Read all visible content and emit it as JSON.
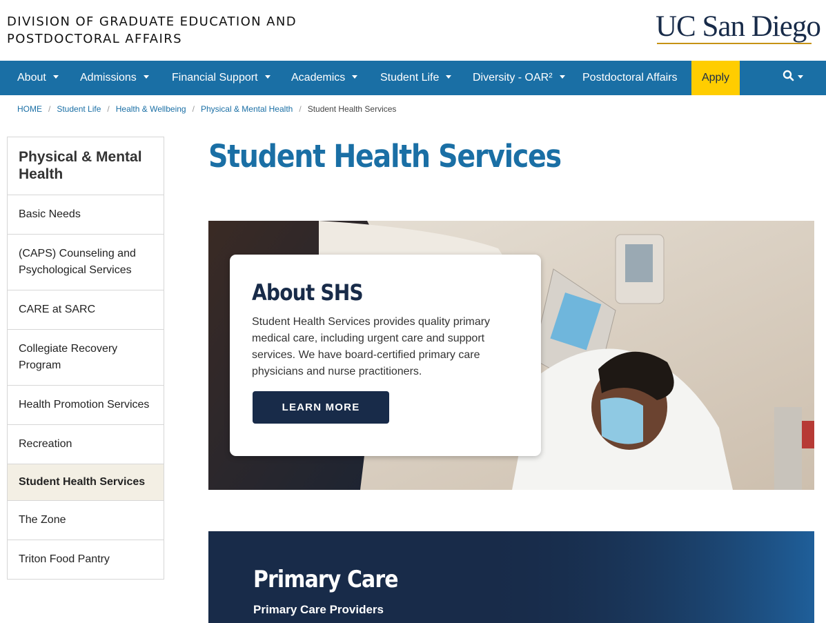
{
  "header": {
    "site_title_line1": "DIVISION OF GRADUATE EDUCATION AND",
    "site_title_line2": "POSTDOCTORAL AFFAIRS",
    "logo_text": "UC San Diego"
  },
  "nav": {
    "items": [
      {
        "label": "About",
        "has_dropdown": true
      },
      {
        "label": "Admissions",
        "has_dropdown": true
      },
      {
        "label": "Financial Support",
        "has_dropdown": true
      },
      {
        "label": "Academics",
        "has_dropdown": true
      },
      {
        "label": "Student Life",
        "has_dropdown": true
      },
      {
        "label": "Diversity - OAR²",
        "has_dropdown": true
      },
      {
        "label": "Postdoctoral Affairs",
        "has_dropdown": false
      }
    ],
    "apply_label": "Apply",
    "search_icon": "search-icon"
  },
  "breadcrumb": {
    "items": [
      "HOME",
      "Student Life",
      "Health & Wellbeing",
      "Physical & Mental Health"
    ],
    "current": "Student Health Services"
  },
  "sidebar": {
    "heading": "Physical & Mental Health",
    "items": [
      {
        "label": "Basic Needs",
        "active": false
      },
      {
        "label": "(CAPS) Counseling and Psychological Services",
        "active": false
      },
      {
        "label": "CARE at SARC",
        "active": false
      },
      {
        "label": "Collegiate Recovery Program",
        "active": false
      },
      {
        "label": "Health Promotion Services",
        "active": false
      },
      {
        "label": "Recreation",
        "active": false
      },
      {
        "label": "Student Health Services",
        "active": true
      },
      {
        "label": "The Zone",
        "active": false
      },
      {
        "label": "Triton Food Pantry",
        "active": false
      }
    ]
  },
  "main": {
    "page_title": "Student Health Services",
    "card": {
      "title": "About SHS",
      "text": "Student Health Services provides quality primary medical care, including urgent care and support services. We have board-certified primary care physicians and nurse practitioners.",
      "button_label": "LEARN MORE"
    },
    "primary_section": {
      "title": "Primary Care",
      "subtitle": "Primary Care Providers"
    }
  },
  "colors": {
    "nav_blue": "#1a6fa5",
    "navy": "#182b49",
    "gold": "#ffcd00",
    "active_bg": "#f3efe4"
  }
}
